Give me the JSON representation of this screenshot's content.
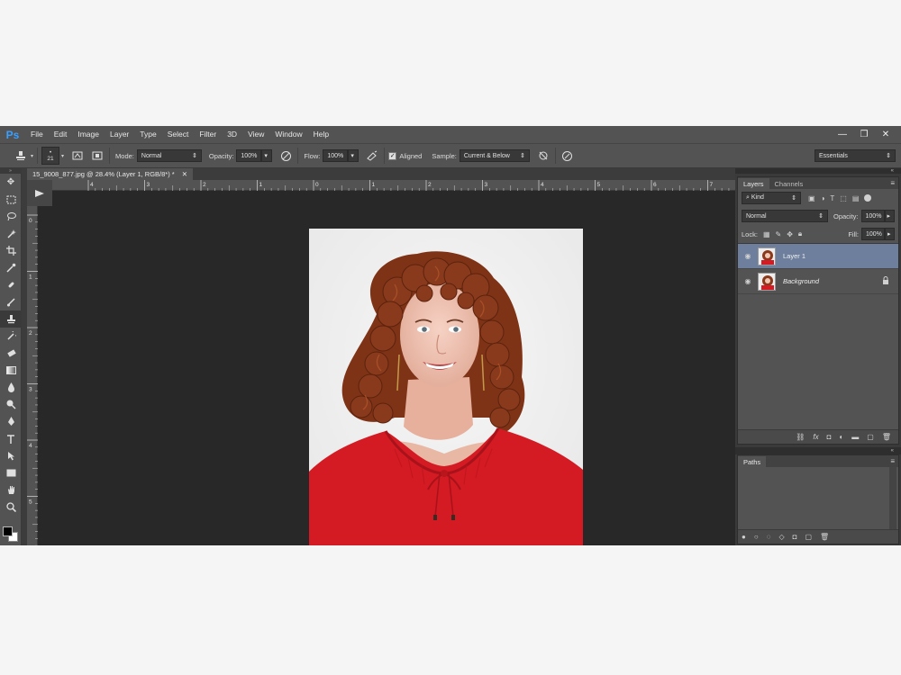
{
  "app": {
    "logo": "Ps",
    "menu": [
      "File",
      "Edit",
      "Image",
      "Layer",
      "Type",
      "Select",
      "Filter",
      "3D",
      "View",
      "Window",
      "Help"
    ],
    "window_controls": [
      "—",
      "❐",
      "✕"
    ]
  },
  "options": {
    "brush_size": "21",
    "mode_label": "Mode:",
    "mode_value": "Normal",
    "opacity_label": "Opacity:",
    "opacity_value": "100%",
    "flow_label": "Flow:",
    "flow_value": "100%",
    "aligned_label": "Aligned",
    "aligned_checked": true,
    "sample_label": "Sample:",
    "sample_value": "Current & Below",
    "workspace": "Essentials"
  },
  "document": {
    "tab_title": "15_9008_877.jpg @ 28.4% (Layer 1, RGB/8*) *",
    "tab_close": "✕",
    "ruler_top_labels": [
      "4",
      "3",
      "2",
      "1",
      "0",
      "1",
      "2",
      "3",
      "4",
      "5",
      "6",
      "7"
    ],
    "ruler_left_labels": [
      "0",
      "1",
      "2",
      "3",
      "4",
      "5"
    ]
  },
  "layers_panel": {
    "tabs": [
      "Layers",
      "Channels"
    ],
    "filter_kind": "Kind",
    "blend_mode": "Normal",
    "opacity_label": "Opacity:",
    "opacity_value": "100%",
    "lock_label": "Lock:",
    "fill_label": "Fill:",
    "fill_value": "100%",
    "layers": [
      {
        "name": "Layer 1",
        "selected": true,
        "italic": false,
        "locked": false
      },
      {
        "name": "Background",
        "selected": false,
        "italic": true,
        "locked": true
      }
    ]
  },
  "paths_panel": {
    "tabs": [
      "Paths"
    ]
  },
  "colors": {
    "accent": "#3aa0ff",
    "selected_layer": "#6d7f9c",
    "shirt_red": "#d41a22",
    "hair": "#8a3a1c"
  }
}
